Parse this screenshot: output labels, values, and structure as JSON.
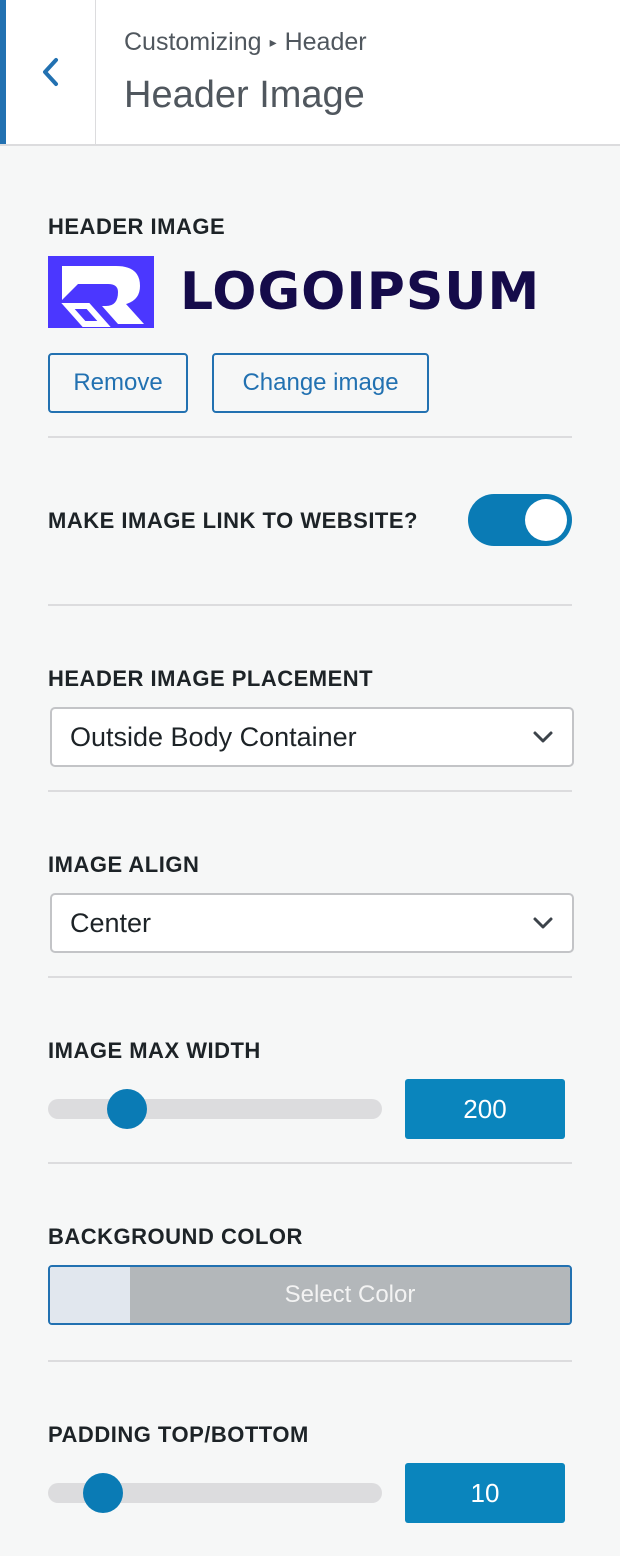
{
  "header": {
    "breadcrumb_root": "Customizing",
    "breadcrumb_sep": "▸",
    "breadcrumb_current": "Header",
    "title": "Header Image",
    "back_icon": "chevron-left-icon"
  },
  "header_image": {
    "label": "Header Image",
    "logo_text": "LOGOIPSUM",
    "remove_label": "Remove",
    "change_label": "Change image"
  },
  "link_toggle": {
    "label": "Make image link to website?",
    "enabled": true
  },
  "placement": {
    "label": "Header Image Placement",
    "selected": "Outside Body Container"
  },
  "align": {
    "label": "Image Align",
    "selected": "Center"
  },
  "max_width": {
    "label": "Image Max Width",
    "value": "200",
    "slider_fraction": 0.2
  },
  "background_color": {
    "label": "Background Color",
    "button_label": "Select Color",
    "swatch_color": "#e1e7ee"
  },
  "padding": {
    "label": "Padding Top/Bottom",
    "value": "10",
    "slider_fraction": 0.12
  },
  "colors": {
    "accent": "#2271b1",
    "toggle_on": "#0a7bb5",
    "logo_mark": "#4b37ff",
    "logo_text": "#150b4a"
  }
}
